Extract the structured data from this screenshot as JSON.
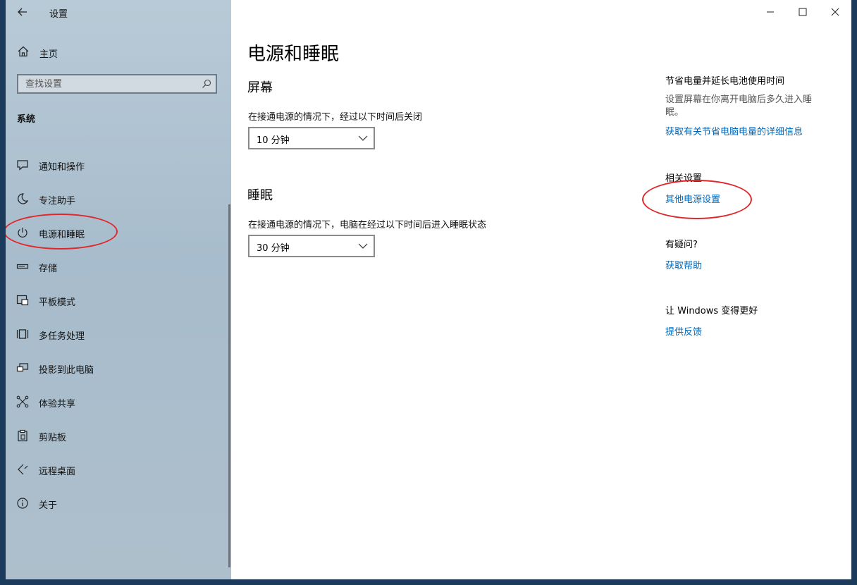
{
  "window": {
    "app_title": "设置",
    "controls": {
      "minimize": "minimize-icon",
      "maximize": "maximize-icon",
      "close": "close-icon"
    }
  },
  "sidebar": {
    "home_label": "主页",
    "search_placeholder": "查找设置",
    "section": "系统",
    "items": [
      {
        "label": "通知和操作",
        "icon": "notification-icon"
      },
      {
        "label": "专注助手",
        "icon": "moon-icon"
      },
      {
        "label": "电源和睡眠",
        "icon": "power-icon",
        "selected": true
      },
      {
        "label": "存储",
        "icon": "storage-icon"
      },
      {
        "label": "平板模式",
        "icon": "tablet-icon"
      },
      {
        "label": "多任务处理",
        "icon": "multitask-icon"
      },
      {
        "label": "投影到此电脑",
        "icon": "project-icon"
      },
      {
        "label": "体验共享",
        "icon": "share-icon"
      },
      {
        "label": "剪贴板",
        "icon": "clipboard-icon"
      },
      {
        "label": "远程桌面",
        "icon": "remote-desktop-icon"
      },
      {
        "label": "关于",
        "icon": "info-icon"
      }
    ]
  },
  "main": {
    "title": "电源和睡眠",
    "screen": {
      "heading": "屏幕",
      "description": "在接通电源的情况下，经过以下时间后关闭",
      "value": "10 分钟"
    },
    "sleep": {
      "heading": "睡眠",
      "description": "在接通电源的情况下，电脑在经过以下时间后进入睡眠状态",
      "value": "30 分钟"
    }
  },
  "aside": {
    "save_power": {
      "heading": "节省电量并延长电池使用时间",
      "description": "设置屏幕在你离开电脑后多久进入睡眠。",
      "link": "获取有关节省电脑电量的详细信息"
    },
    "related": {
      "heading": "相关设置",
      "link": "其他电源设置"
    },
    "question": {
      "heading": "有疑问?",
      "link": "获取帮助"
    },
    "improve": {
      "heading": "让 Windows 变得更好",
      "link": "提供反馈"
    }
  },
  "colors": {
    "link": "#0067b8",
    "annotation": "#e0272b",
    "sidebar_bg": "#aebfcc"
  }
}
